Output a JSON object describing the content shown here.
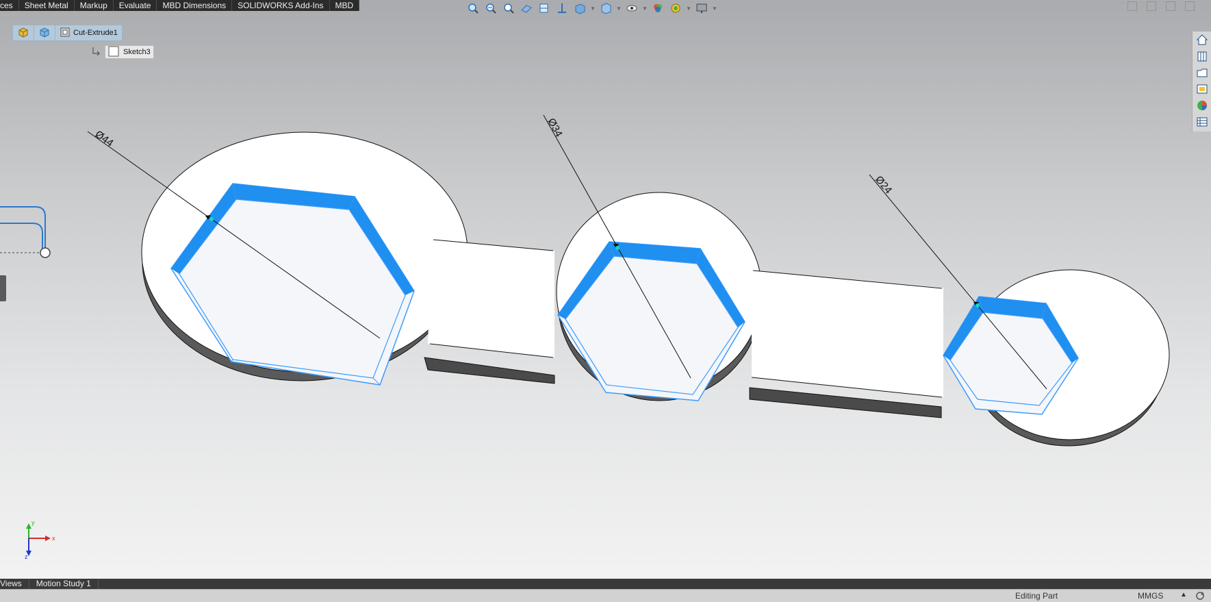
{
  "ribbon_tabs": [
    "ces",
    "Sheet Metal",
    "Markup",
    "Evaluate",
    "MBD Dimensions",
    "SOLIDWORKS Add-Ins",
    "MBD"
  ],
  "hud_icons": [
    "zoom-to-fit-icon",
    "zoom-to-area-icon",
    "previous-view-icon",
    "section-view-icon",
    "dynamic-annotation-icon",
    "view-orientation-icon",
    "display-style-icon",
    "hide-show-icon",
    "edit-appearance-icon",
    "apply-scene-icon",
    "view-settings-icon"
  ],
  "breadcrumb": {
    "items": [
      {
        "icon": "part-icon",
        "label": ""
      },
      {
        "icon": "body-icon",
        "label": ""
      },
      {
        "icon": "feature-icon",
        "label": "Cut-Extrude1"
      }
    ],
    "child": "Sketch3"
  },
  "dimensions": [
    {
      "label": "Ø44",
      "value": 44
    },
    {
      "label": "Ø34",
      "value": 34
    },
    {
      "label": "Ø24",
      "value": 24
    }
  ],
  "triad": {
    "x": "x",
    "y": "y",
    "z": "z"
  },
  "bottom_tabs": [
    "Views",
    "Motion Study 1"
  ],
  "status": {
    "mode": "Editing Part",
    "units": "MMGS"
  },
  "task_pane": [
    "home-icon",
    "resources-icon",
    "design-library-icon",
    "file-explorer-icon",
    "appearances-icon",
    "custom-properties-icon"
  ],
  "colors": {
    "highlight_face": "#1f8ff0",
    "edge_highlight": "#3c9bff",
    "part_top": "#ffffff",
    "part_side": "#595959",
    "tab_bar": "#2b2b2b"
  }
}
